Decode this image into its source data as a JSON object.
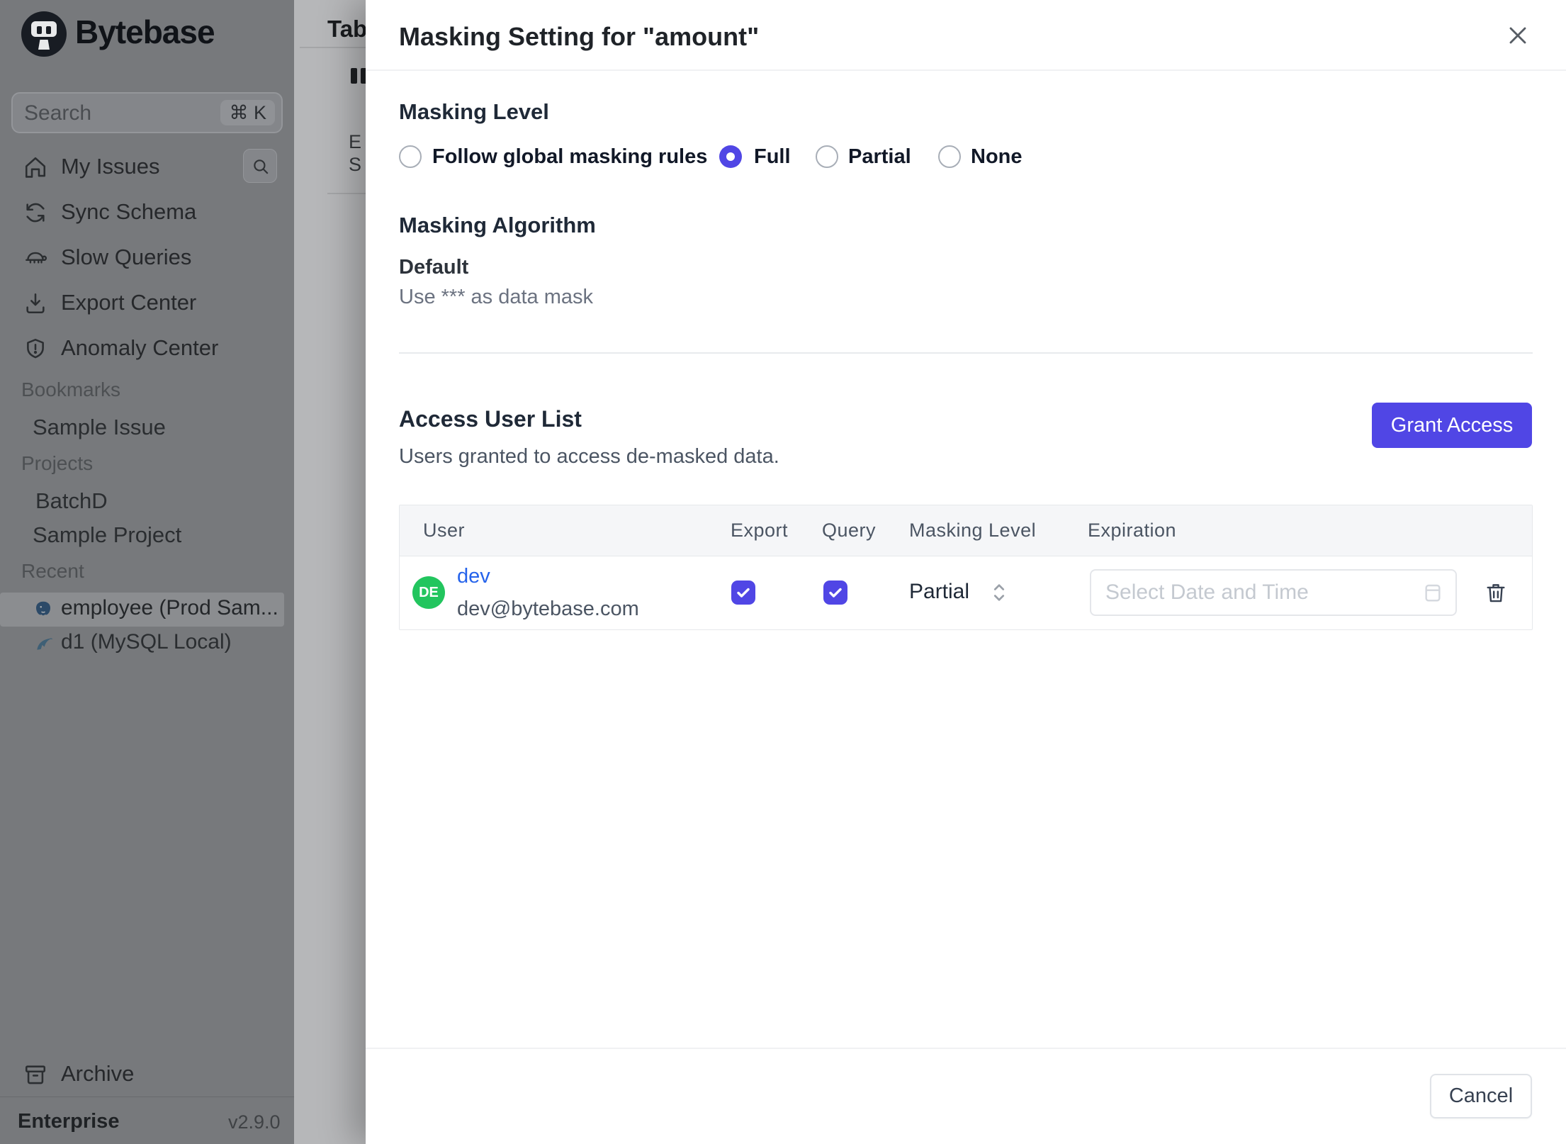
{
  "colors": {
    "accent": "#5046e5",
    "link_blue": "#2563eb",
    "avatar_green": "#22c55e"
  },
  "sidebar": {
    "brand": "Bytebase",
    "search": {
      "placeholder": "Search",
      "shortcut": "⌘ K"
    },
    "nav": [
      {
        "label": "My Issues",
        "icon": "home-icon"
      },
      {
        "label": "Sync Schema",
        "icon": "sync-icon"
      },
      {
        "label": "Slow Queries",
        "icon": "turtle-icon"
      },
      {
        "label": "Export Center",
        "icon": "download-icon"
      },
      {
        "label": "Anomaly Center",
        "icon": "shield-icon"
      }
    ],
    "sections": [
      {
        "title": "Bookmarks",
        "items": [
          {
            "label": "Sample Issue"
          }
        ]
      },
      {
        "title": "Projects",
        "items": [
          {
            "label": "BatchD"
          },
          {
            "label": "Sample Project"
          }
        ]
      },
      {
        "title": "Recent",
        "items": [
          {
            "label": "employee (Prod Sam...",
            "icon": "postgres-icon",
            "highlighted": true
          },
          {
            "label": "d1 (MySQL Local)",
            "icon": "mysql-icon",
            "highlighted": false
          }
        ]
      }
    ],
    "archive_label": "Archive",
    "plan": "Enterprise",
    "version": "v2.9.0"
  },
  "underlay": {
    "tab_title": "Tab",
    "label_e": "E",
    "label_s": "S"
  },
  "modal": {
    "title": "Masking Setting for \"amount\"",
    "masking_level": {
      "heading": "Masking Level",
      "options": [
        {
          "label": "Follow global masking rules",
          "selected": false
        },
        {
          "label": "Full",
          "selected": true
        },
        {
          "label": "Partial",
          "selected": false
        },
        {
          "label": "None",
          "selected": false
        }
      ]
    },
    "algorithm": {
      "heading": "Masking Algorithm",
      "name": "Default",
      "description": "Use *** as data mask"
    },
    "access": {
      "heading": "Access User List",
      "description": "Users granted to access de-masked data.",
      "grant_button": "Grant Access"
    },
    "table": {
      "headers": [
        "User",
        "Export",
        "Query",
        "Masking Level",
        "Expiration"
      ],
      "row": {
        "avatar": "DE",
        "name": "dev",
        "email": "dev@bytebase.com",
        "export_checked": true,
        "query_checked": true,
        "masking_level": "Partial",
        "expiration_placeholder": "Select Date and Time"
      }
    },
    "footer": {
      "cancel_label": "Cancel"
    }
  }
}
